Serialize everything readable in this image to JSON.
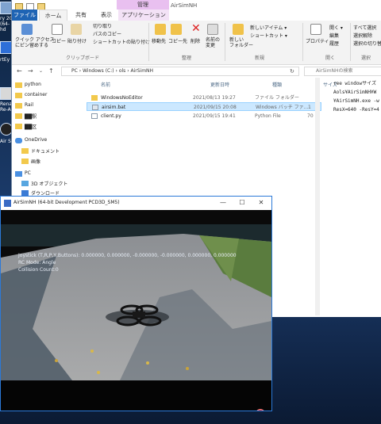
{
  "desktop": {
    "labels": [
      "ry 20",
      "(64-",
      "hd",
      "rtEy",
      "Rena",
      "Re-A",
      "Air S"
    ]
  },
  "explorer": {
    "title": "AirSimNH",
    "context_tab": "管理",
    "tabs": {
      "file": "ファイル",
      "home": "ホーム",
      "share": "共有",
      "view": "表示",
      "apptools": "アプリケーション ツール"
    },
    "ribbon": {
      "pin": "クイック アクセス\nにピン留めする",
      "copy": "コピー",
      "paste": "貼り付け",
      "cut": "切り取り",
      "copypath": "パスのコピー",
      "shortcut": "ショートカットの貼り付け",
      "moveto": "移動先",
      "copyto": "コピー先",
      "delete": "削除",
      "rename": "名前の\n変更",
      "newfolder": "新しい\nフォルダー",
      "newitem": "新しいアイテム ▾",
      "shortcut2": "ショートカット ▾",
      "properties": "プロパティ",
      "open": "開く ▾",
      "edit": "編集",
      "history": "履歴",
      "selectall": "すべて選択",
      "selectnone": "選択解除",
      "invert": "選択の切り替え",
      "grp_clipboard": "クリップボード",
      "grp_organize": "整理",
      "grp_new": "新規",
      "grp_open": "開く",
      "grp_select": "選択"
    },
    "address": "PC  ›  Windows (C:)  ›  ols  ›  AirSimNH",
    "search_placeholder": "AirSimNHの検索",
    "columns": {
      "name": "名前",
      "date": "更新日時",
      "type": "種類",
      "size": "サイズ"
    },
    "files": [
      {
        "name": "WindowsNoEditor",
        "date": "2021/08/13 19:27",
        "type": "ファイル フォルダー",
        "size": ""
      },
      {
        "name": "airsim.bat",
        "date": "2021/09/15 20:08",
        "type": "Windows バッチ ファ...",
        "size": "1"
      },
      {
        "name": "client.py",
        "date": "2021/09/15 19:41",
        "type": "Python File",
        "size": "70"
      }
    ],
    "nav": [
      "python",
      "container",
      "Rail",
      "██駅",
      "██区",
      "OneDrive",
      "ドキュメント",
      "画像",
      "PC",
      "3D オブジェクト",
      "ダウンロード"
    ],
    "cmd_text": "ree windowサイズ\nAols¥AirSimNH¥W\n¥AirSimNH.exe -w\nResX=640 -ResY=4"
  },
  "sim": {
    "title": "AirSimNH (64-bit Development PCD3D_SM5)",
    "hud": [
      "Joystick (T,R,P,Y,Buttons): 0.000000, 0.000000, -0.000000, -0.000000, 0.000000, 0.000000",
      "RC Mode: Angle",
      "Collision Count:0"
    ]
  }
}
